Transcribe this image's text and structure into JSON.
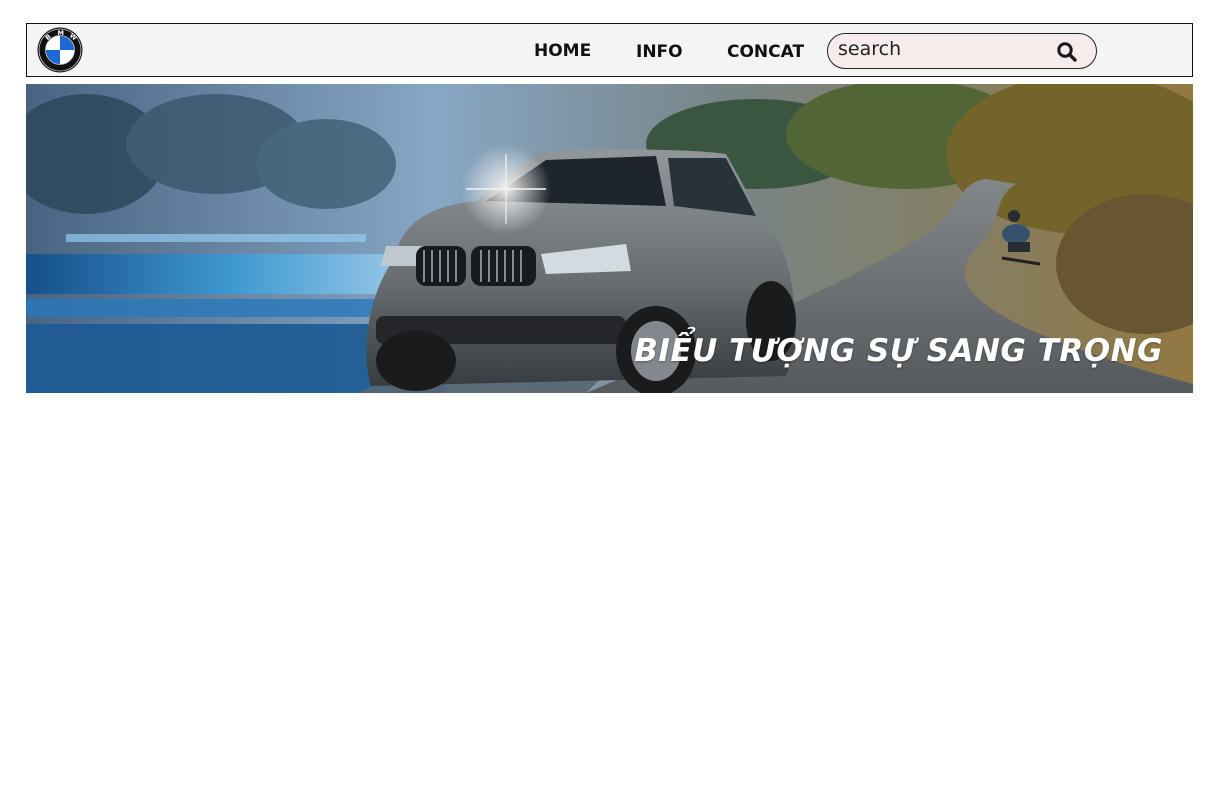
{
  "header": {
    "logo_alt": "BMW",
    "nav": [
      {
        "label": "HOME"
      },
      {
        "label": "INFO"
      },
      {
        "label": "CONCAT"
      }
    ],
    "search": {
      "placeholder": "search",
      "icon": "search-icon"
    }
  },
  "banner": {
    "slogan": "BIỂU TƯỢNG SỰ SANG TRỌNG",
    "image": "bmw-suv-on-road-banner"
  },
  "colors": {
    "header_bg": "#f4f4f4",
    "search_bg": "#f6ecec",
    "bmw_blue": "#1c69d4"
  }
}
